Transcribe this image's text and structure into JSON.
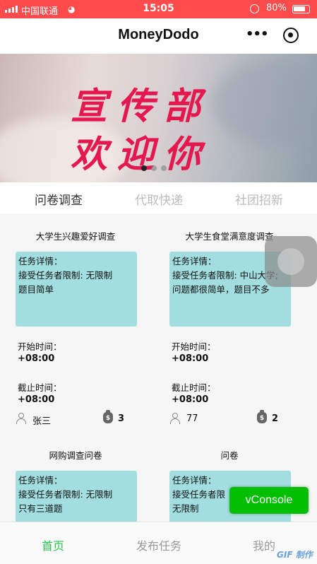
{
  "status_bar": {
    "carrier": "中国联通",
    "time": "15:05",
    "battery": "80%",
    "battery_level": 0.8,
    "icons": [
      "signal-icon",
      "wifi-icon",
      "rotation-lock-icon",
      "battery-icon"
    ]
  },
  "nav": {
    "title": "MoneyDodo",
    "more_icon": "more-dots-icon",
    "close_icon": "capsule-close-icon"
  },
  "banner": {
    "line1": "宣传部",
    "line2": "欢迎你",
    "text_color": "#e4174e",
    "slides": 3,
    "active_slide": 1
  },
  "tabs": [
    {
      "label": "问卷调查",
      "active": true
    },
    {
      "label": "代取快递",
      "active": false
    },
    {
      "label": "社团招新",
      "active": false
    }
  ],
  "tasks": [
    {
      "title": "大学生兴趣爱好调查",
      "detail_label": "任务详情：",
      "detail_lines": [
        "接受任务者限制: 无限制",
        "题目简单"
      ],
      "start_label": "开始时间：",
      "start_value": "+08:00",
      "end_label": "截止时间：",
      "end_value": "+08:00",
      "publisher": "张三",
      "reward": "3"
    },
    {
      "title": "大学生食堂满意度调查",
      "detail_label": "任务详情：",
      "detail_lines": [
        "接受任务者限制: 中山大学;",
        "问题都很简单，题目不多"
      ],
      "start_label": "开始时间：",
      "start_value": "+08:00",
      "end_label": "截止时间：",
      "end_value": "+08:00",
      "publisher": "77",
      "reward": "2"
    },
    {
      "title": "网购调查问卷",
      "detail_label": "任务详情：",
      "detail_lines": [
        "接受任务者限制: 无限制",
        "只有三道题"
      ]
    },
    {
      "title": "问卷",
      "detail_label": "任务详情：",
      "detail_lines": [
        "接受任务者限",
        "无限制"
      ]
    }
  ],
  "accent_colors": {
    "detail_box": "#a2dde0",
    "status_bar": "#ff4b4b",
    "active_tab": "#2bc44d",
    "vconsole": "#04be02"
  },
  "vconsole": {
    "label": "vConsole"
  },
  "tab_bar": [
    {
      "label": "首页",
      "active": true
    },
    {
      "label": "发布任务",
      "active": false
    },
    {
      "label": "我的",
      "active": false
    }
  ],
  "watermark": "GIF 制作"
}
